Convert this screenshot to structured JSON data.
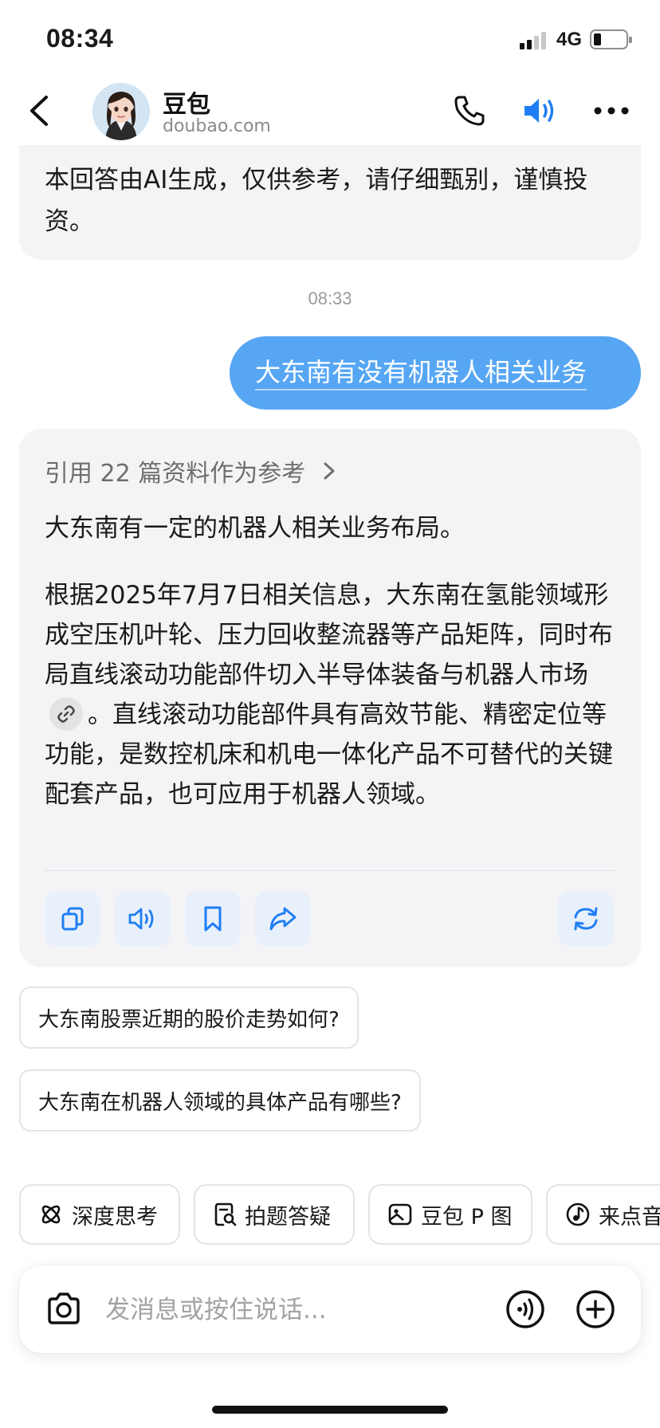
{
  "status_bar": {
    "time": "08:34",
    "network": "4G",
    "battery_level": 0.2
  },
  "nav": {
    "title": "豆包",
    "subtitle": "doubao.com"
  },
  "chat": {
    "previous_message_tail": "本回答由AI生成，仅供参考，请仔细甄别，谨慎投资。",
    "timestamp": "08:33",
    "user_message": "大东南有没有机器人相关业务",
    "answer": {
      "reference": "引用 22 篇资料作为参考",
      "paragraph_1": "大东南有一定的机器人相关业务布局。",
      "paragraph_2_before_link": "根据2025年7月7日相关信息，大东南在氢能领域形成空压机叶轮、压力回收整流器等产品矩阵，同时布局直线滚动功能部件切入半导体装备与机器人市场",
      "paragraph_2_after_link": "。直线滚动功能部件具有高效节能、精密定位等功能，是数控机床和机电一体化产品不可替代的关键配套产品，也可应用于机器人领域。"
    },
    "suggestions": [
      "大东南股票近期的股价走势如何?",
      "大东南在机器人领域的具体产品有哪些?"
    ]
  },
  "tools": [
    "深度思考",
    "拍题答疑",
    "豆包 P 图",
    "来点音"
  ],
  "input": {
    "placeholder": "发消息或按住说话..."
  },
  "colors": {
    "accent": "#1f7ef5",
    "user_bubble": "#56a6f4",
    "card_bg": "#f4f4f6"
  }
}
